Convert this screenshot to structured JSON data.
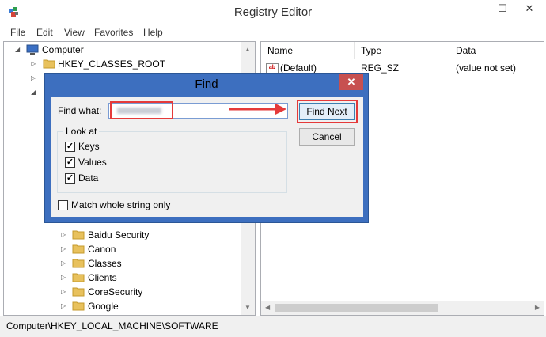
{
  "window": {
    "title": "Registry Editor"
  },
  "menu": [
    "File",
    "Edit",
    "View",
    "Favorites",
    "Help"
  ],
  "tree": {
    "root": "Computer",
    "top_items": [
      "HKEY_CLASSES_ROOT"
    ],
    "software_items": [
      "Baidu Security",
      "Canon",
      "Classes",
      "Clients",
      "CoreSecurity",
      "Google"
    ]
  },
  "list": {
    "columns": [
      "Name",
      "Type",
      "Data"
    ],
    "rows": [
      {
        "name": "(Default)",
        "type": "REG_SZ",
        "data": "(value not set)"
      }
    ]
  },
  "status": {
    "path": "Computer\\HKEY_LOCAL_MACHINE\\SOFTWARE"
  },
  "dialog": {
    "title": "Find",
    "find_what_label": "Find what:",
    "find_next": "Find Next",
    "cancel": "Cancel",
    "look_at": "Look at",
    "keys": "Keys",
    "values": "Values",
    "data": "Data",
    "match_whole": "Match whole string only",
    "options_checked": {
      "keys": true,
      "values": true,
      "data": true,
      "match_whole": false
    }
  },
  "colors": {
    "dialog_frame": "#3d6fbf",
    "close_button": "#c75050",
    "highlight": "#e53a3a",
    "folder": "#e8c15d"
  }
}
